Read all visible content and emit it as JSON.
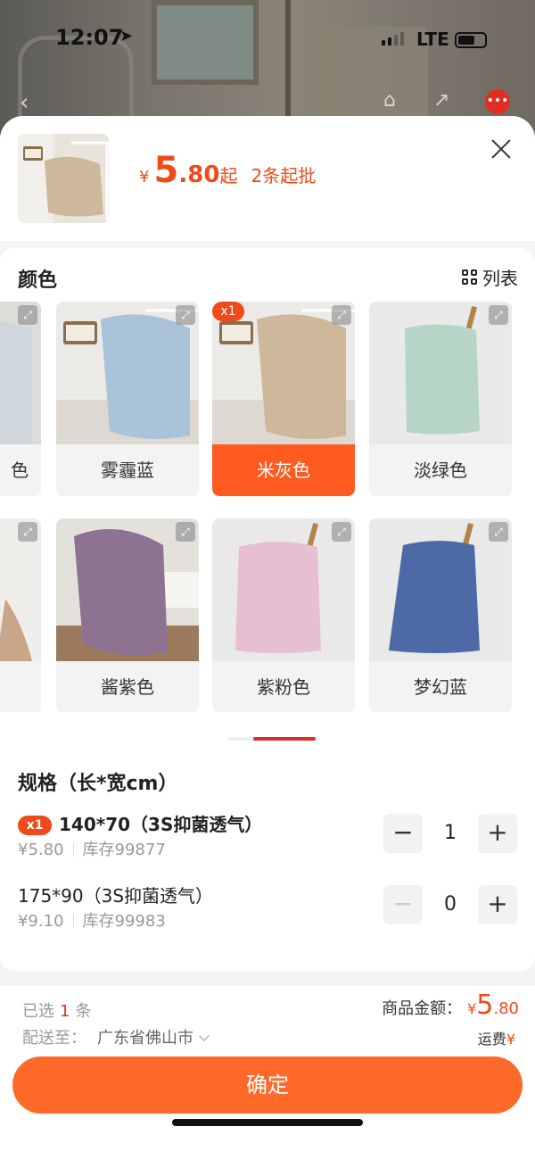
{
  "status": {
    "time": "12:07",
    "network": "LTE"
  },
  "product": {
    "currency": "¥",
    "price_int": "5",
    "price_dec": ".80",
    "price_suffix": "起",
    "min_batch": "2条起批"
  },
  "color_section": {
    "title": "颜色",
    "list_label": "列表",
    "selected_badge": "x1",
    "items": [
      {
        "label": "色",
        "color": "#cfd6dc"
      },
      {
        "label": "雾霾蓝",
        "color": "#a9c3d8"
      },
      {
        "label": "米灰色",
        "color": "#cdb89c"
      },
      {
        "label": "淡绿色",
        "color": "#b6d5c6"
      },
      {
        "label": "",
        "color": "#e7e2dc"
      },
      {
        "label": "酱紫色",
        "color": "#8d7391"
      },
      {
        "label": "紫粉色",
        "color": "#e6bfd0"
      },
      {
        "label": "梦幻蓝",
        "color": "#4d6aa6"
      }
    ]
  },
  "spec_section": {
    "title": "规格（长*宽cm）",
    "items": [
      {
        "badge": "x1",
        "name": "140*70（3S抑菌透气）",
        "price": "¥5.80",
        "stock": "库存99877",
        "qty": "1"
      },
      {
        "badge": "",
        "name": "175*90（3S抑菌透气）",
        "price": "¥9.10",
        "stock": "库存99983",
        "qty": "0"
      }
    ]
  },
  "footer": {
    "selected_prefix": "已选",
    "selected_count": "1",
    "selected_unit": "条",
    "ship_label": "配送至：",
    "ship_address": "广东省佛山市",
    "amount_label": "商品金额：",
    "amount_currency": "¥",
    "amount_int": "5",
    "amount_dec": ".80",
    "freight_label": "运费",
    "freight_currency": "¥",
    "confirm_label": "确定"
  },
  "colors": {
    "accent": "#ff6a2b",
    "price": "#f04a1a",
    "badge": "#e02e24"
  }
}
